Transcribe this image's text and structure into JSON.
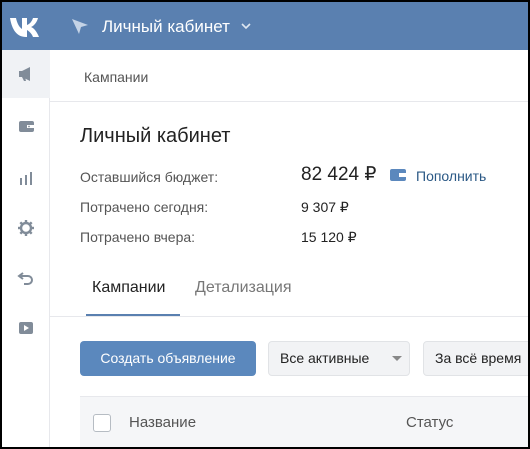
{
  "header": {
    "logo_text": "VK",
    "title": "Личный кабинет"
  },
  "sidebar": {
    "items": [
      {
        "icon": "megaphone-icon",
        "active": true
      },
      {
        "icon": "wallet-icon",
        "active": false
      },
      {
        "icon": "bar-chart-icon",
        "active": false
      },
      {
        "icon": "gear-icon",
        "active": false
      },
      {
        "icon": "undo-icon",
        "active": false
      },
      {
        "icon": "video-icon",
        "active": false
      }
    ]
  },
  "breadcrumb": "Кампании",
  "page": {
    "title": "Личный кабинет",
    "budget_label": "Оставшийся бюджет:",
    "budget_value": "82 424 ₽",
    "topup_label": "Пополнить",
    "spent_today_label": "Потрачено сегодня:",
    "spent_today_value": "9 307 ₽",
    "spent_yesterday_label": "Потрачено вчера:",
    "spent_yesterday_value": "15 120 ₽"
  },
  "tabs": [
    {
      "label": "Кампании",
      "active": true
    },
    {
      "label": "Детализация",
      "active": false
    }
  ],
  "toolbar": {
    "create_label": "Создать объявление",
    "filter_status": "Все активные",
    "filter_period": "За всё время"
  },
  "table": {
    "columns": [
      "Название",
      "Статус"
    ]
  },
  "colors": {
    "header_bg": "#5a80b0",
    "primary_button": "#5b88bd",
    "link": "#2a5885"
  }
}
